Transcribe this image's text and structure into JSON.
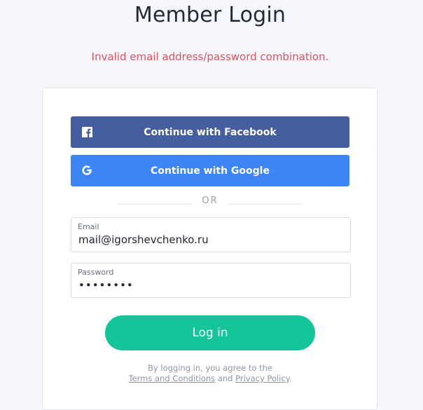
{
  "page": {
    "title": "Member Login",
    "error_message": "Invalid email address/password combination."
  },
  "social": {
    "facebook_label": "Continue with Facebook",
    "facebook_icon": "facebook-icon",
    "facebook_color": "#455e9f",
    "google_label": "Continue with Google",
    "google_icon": "google-icon",
    "google_color": "#3d84f4"
  },
  "divider": {
    "text": "OR"
  },
  "form": {
    "email_label": "Email",
    "email_value": "mail@igorshevchenko.ru",
    "password_label": "Password",
    "password_value": "••••••••",
    "login_label": "Log in",
    "login_color": "#14c59a"
  },
  "terms": {
    "prefix": "By logging in, you agree to the",
    "terms_link": "Terms and Conditions",
    "and": "and",
    "privacy_link": "Privacy Policy",
    "suffix": "."
  }
}
